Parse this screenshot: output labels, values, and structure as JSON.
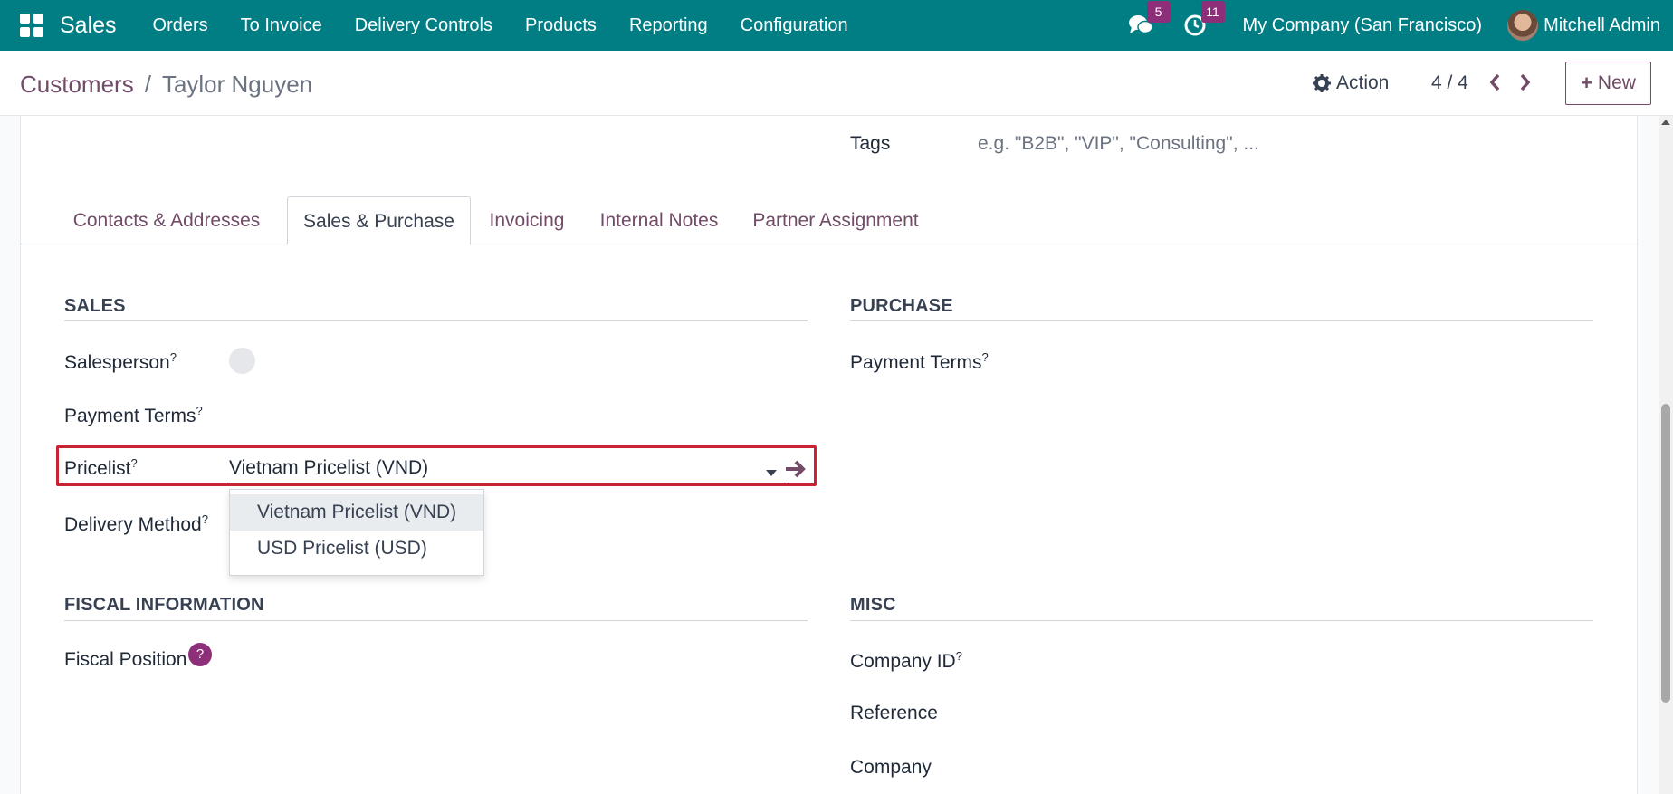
{
  "navbar": {
    "app_name": "Sales",
    "menu": [
      "Orders",
      "To Invoice",
      "Delivery Controls",
      "Products",
      "Reporting",
      "Configuration"
    ],
    "messages_count": "5",
    "activities_count": "11",
    "company": "My Company (San Francisco)",
    "user": "Mitchell Admin",
    "accent_color": "#017e84"
  },
  "control": {
    "breadcrumb_parent": "Customers",
    "breadcrumb_sep": "/",
    "breadcrumb_current": "Taylor Nguyen",
    "action_label": "Action",
    "pager": "4 / 4",
    "prev_icon": "‹",
    "next_icon": "›",
    "new_plus": "+",
    "new_label": "New"
  },
  "form": {
    "tags_label": "Tags",
    "tags_placeholder": "e.g. \"B2B\", \"VIP\", \"Consulting\", ...",
    "tabs": [
      "Contacts & Addresses",
      "Sales & Purchase",
      "Invoicing",
      "Internal Notes",
      "Partner Assignment"
    ],
    "active_tab": "Sales & Purchase",
    "sales": {
      "title": "SALES",
      "salesperson": "Salesperson",
      "payment_terms": "Payment Terms",
      "pricelist": "Pricelist",
      "pricelist_value": "Vietnam Pricelist (VND)",
      "delivery_method": "Delivery Method"
    },
    "purchase": {
      "title": "PURCHASE",
      "payment_terms": "Payment Terms"
    },
    "fiscal": {
      "title": "FISCAL INFORMATION",
      "fiscal_position": "Fiscal Position",
      "help": "?"
    },
    "misc": {
      "title": "MISC",
      "company_id": "Company ID",
      "reference": "Reference",
      "company": "Company"
    },
    "help_mark": "?",
    "pricelist_options": [
      "Vietnam Pricelist (VND)",
      "USD Pricelist (USD)"
    ]
  }
}
